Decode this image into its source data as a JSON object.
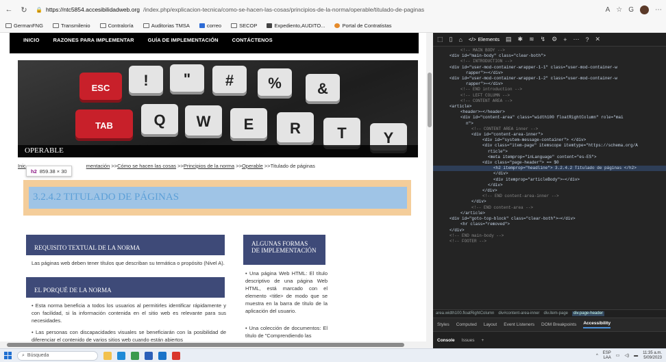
{
  "browser": {
    "url_host": "https://ntc5854.accesibilidadweb.org",
    "url_path": "/index.php/explicacion-tecnica/como-se-hacen-las-cosas/principios-de-la-norma/operable/titulado-de-paginas",
    "bookmarks": [
      "GermanFNG",
      "Transmilenio",
      "Contraloría",
      "Auditorias TMSA",
      "correo",
      "SECOP",
      "Expediento,AUDITO...",
      "Portal de Contratistas"
    ]
  },
  "site": {
    "menu": [
      "INICIO",
      "RAZONES PARA IMPLEMENTAR",
      "GUÍA DE IMPLEMENTACIÓN",
      "CONTÁCTENOS"
    ],
    "keys": [
      "ESC",
      "!",
      "\"",
      "#",
      "%",
      "&",
      "TAB",
      "Q",
      "W",
      "E",
      "R",
      "T",
      "Y"
    ],
    "hero_title": "OPERABLE",
    "breadcrumb": {
      "start": "Inic",
      "mid": "mentación",
      "items": [
        "Cómo se hacen las cosas",
        "Principios de la norma",
        "Operable"
      ],
      "current": "Titulado de páginas",
      "sep": ">>"
    },
    "tooltip": {
      "tag": "h2",
      "size": "859.38 × 30"
    },
    "headline": "3.2.4.2 TITULADO DE PÁGINAS",
    "sections": {
      "req_title": "REQUISITO TEXTUAL DE LA NORMA",
      "req_text": "Las páginas web deben tener títulos que describan su temática o propósito (Nivel A).",
      "why_title": "EL PORQUÉ DE LA NORMA",
      "why_text1": "• Esta norma beneficia a todos los usuarios al permitirles identificar rápidamente y con facilidad, si la información contenida en el sitio web es relevante para sus necesidades.",
      "why_text2": "• Las personas con discapacidades visuales se beneficiarán con la posibilidad de diferenciar el contenido de varios sitios web cuando están abiertos",
      "impl_title": "ALGUNAS FORMAS DE IMPLEMENTACIÓN",
      "impl_text1": "• Una página Web HTML: El título descriptivo de una página Web HTML, está marcado con el elemento <title> de modo que se muestra en la barra de título de la aplicación del usuario.",
      "impl_text2": "• Una colección de documentos: El título de \"Comprendiendo las"
    }
  },
  "devtools": {
    "elements_tab": "Elements",
    "dom_lines": [
      "<!-- MAIN BODY -->",
      "<div id=\"main-body\" class=\"clear-both\">",
      "<!-- INTRODUCTION -->",
      "<div id=\"user-mod-container-wrapper-1-1\" class=\"user-mod-container-w",
      "rapper\">⋯</div>",
      "<div id=\"user-mod-container-wrapper-1-2\" class=\"user-mod-container-w",
      "rapper\">⋯</div>",
      "<!-- END introduction -->",
      "<!-- LEFT COLUMN -->",
      "<!-- CONTENT AREA -->",
      "<article>",
      "<header>⋯</header>",
      "<div id=\"content-area\" class=\"width100 floatRightColumn\" role=\"mai",
      "n\">",
      "<!-- CONTENT AREA inner -->",
      "<div id=\"content-area-inner\">",
      "<div id=\"system-message-container\"> </div>",
      "<div class=\"item-page\" itemscope itemtype=\"https://schema.org/A",
      "rticle\">",
      "<meta itemprop=\"inLanguage\" content=\"es-ES\">",
      "<div class=\"page-header\"> == $0",
      "<h2 itemprop=\"headline\"> 3.2.4.2 Titulado de páginas </h2>",
      "</div>",
      "<div itemprop=\"articleBody\">⋯</div>",
      "</div>",
      "</div>",
      "<!-- END content-area-inner -->",
      "</div>",
      "<!-- END content-area -->",
      "</article>",
      "<div id=\"goto-top-block\" class=\"clear-both\">⋯</div>",
      "<hr class=\"removed\">",
      "</div>",
      "<!-- END main-body -->",
      "<!-- FOOTER -->"
    ],
    "crumbs": [
      "area.width100.floatRightColumn",
      "div#content-area-inner",
      "div.item-page",
      "div.page-header"
    ],
    "subtabs": [
      "Styles",
      "Computed",
      "Layout",
      "Event Listeners",
      "DOM Breakpoints",
      "Accessibility"
    ],
    "drawer": [
      "Console",
      "Issues"
    ]
  },
  "taskbar": {
    "search_placeholder": "Búsqueda",
    "lang": "ESP",
    "lang2": "LAA",
    "time": "11:35 a.m.",
    "date": "5/09/2023"
  }
}
